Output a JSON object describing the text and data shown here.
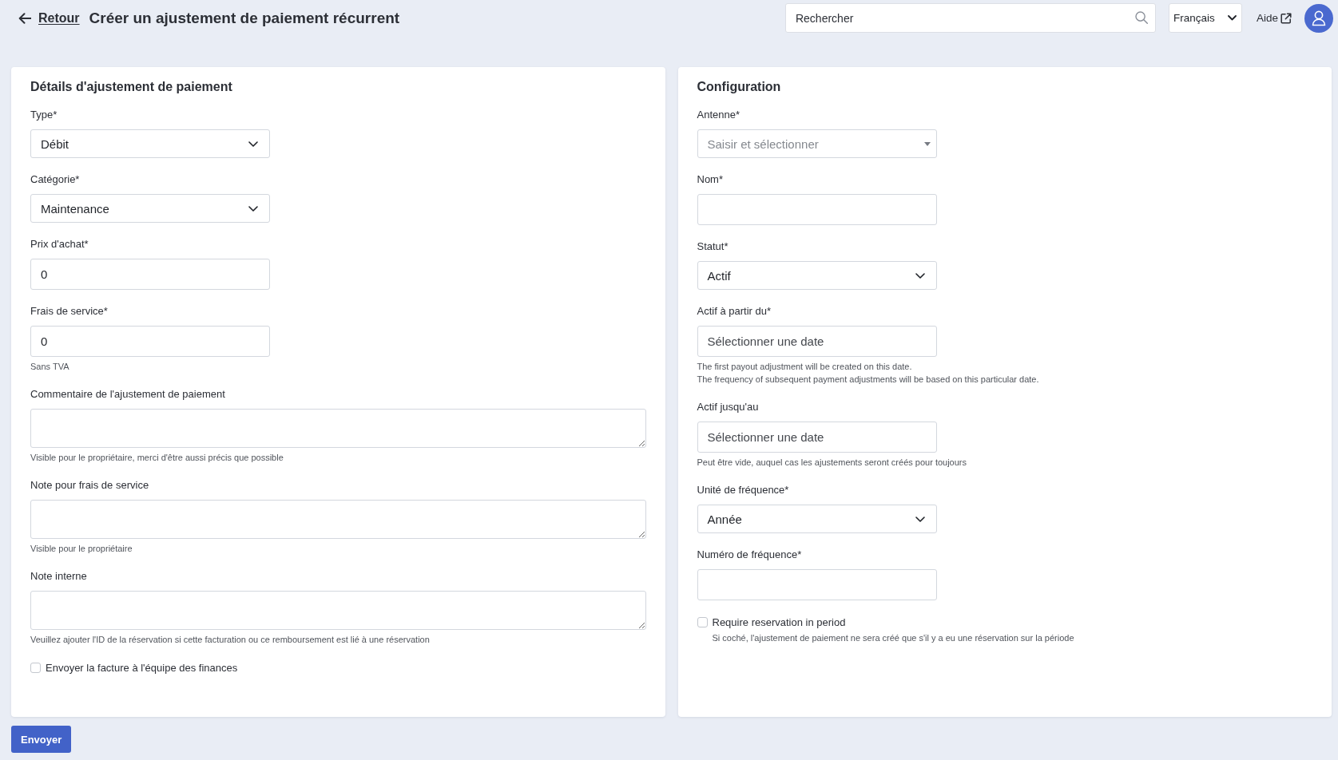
{
  "header": {
    "back_link": "Retour",
    "title": "Créer un ajustement de paiement récurrent",
    "search": {
      "placeholder": "Rechercher"
    },
    "language_select": {
      "value": "Français"
    },
    "help_link": "Aide"
  },
  "panels": [
    {
      "title": "Détails d'ajustement de paiement",
      "fields": [
        {
          "kind": "select",
          "label": "Type*",
          "value": "Débit"
        },
        {
          "kind": "select",
          "label": "Catégorie*",
          "value": "Maintenance"
        },
        {
          "kind": "input",
          "label": "Prix d'achat*",
          "value": "0"
        },
        {
          "kind": "input",
          "label": "Frais de service*",
          "value": "0",
          "hints": [
            "Sans TVA"
          ]
        },
        {
          "kind": "textarea",
          "label": "Commentaire de l'ajustement de paiement",
          "hints": [
            "Visible pour le propriétaire, merci d'être aussi précis que possible"
          ]
        },
        {
          "kind": "textarea",
          "label": "Note pour frais de service",
          "hints": [
            "Visible pour le propriétaire"
          ]
        },
        {
          "kind": "textarea",
          "label": "Note interne",
          "hints": [
            "Veuillez ajouter l'ID de la réservation si cette facturation ou ce remboursement est lié à une réservation"
          ]
        },
        {
          "kind": "checkbox",
          "label": "Envoyer la facture à l'équipe des finances",
          "checked": false
        }
      ]
    },
    {
      "title": "Configuration",
      "fields": [
        {
          "kind": "combobox",
          "label": "Antenne*",
          "placeholder": "Saisir et sélectionner"
        },
        {
          "kind": "input",
          "label": "Nom*"
        },
        {
          "kind": "select",
          "label": "Statut*",
          "value": "Actif"
        },
        {
          "kind": "date",
          "label": "Actif à partir du*",
          "placeholder": "Sélectionner une date",
          "hints": [
            "The first payout adjustment will be created on this date.",
            "The frequency of subsequent payment adjustments will be based on this particular date."
          ]
        },
        {
          "kind": "date",
          "label": "Actif jusqu'au",
          "placeholder": "Sélectionner une date",
          "hints": [
            "Peut être vide, auquel cas les ajustements seront créés pour toujours"
          ]
        },
        {
          "kind": "select",
          "label": "Unité de fréquence*",
          "value": "Année"
        },
        {
          "kind": "input",
          "label": "Numéro de fréquence*"
        },
        {
          "kind": "checkbox",
          "label": "Require reservation in period",
          "checked": false,
          "hints": [
            "Si coché, l'ajustement de paiement ne sera créé que s'il y a eu une réservation sur la période"
          ]
        }
      ]
    }
  ],
  "submit_button": "Envoyer"
}
